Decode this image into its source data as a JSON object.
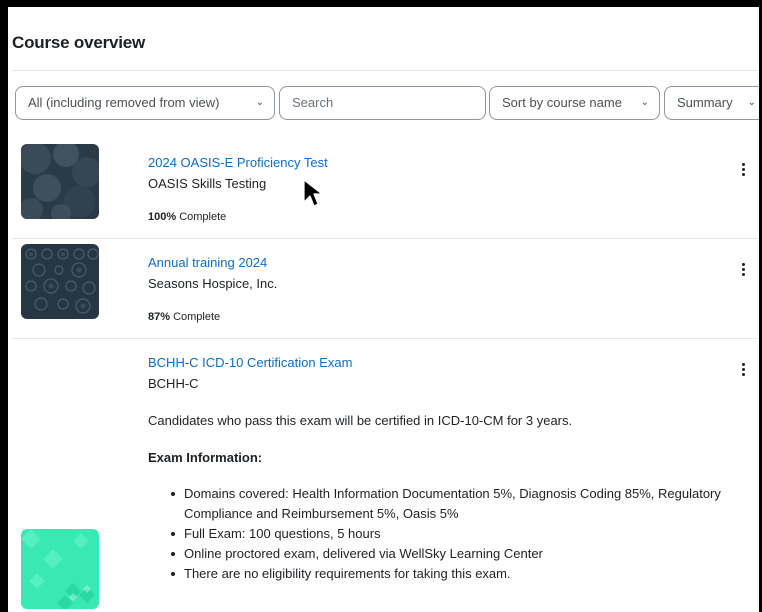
{
  "block": {
    "title": "Course overview"
  },
  "controls": {
    "filter_label": "All (including removed from view)",
    "search_placeholder": "Search",
    "sort_label": "Sort by course name",
    "view_label": "Summary"
  },
  "courses": [
    {
      "name": "2024 OASIS-E Proficiency Test",
      "category": "OASIS Skills Testing",
      "progress_value": "100%",
      "progress_suffix": " Complete",
      "progress_fraction": 1.0
    },
    {
      "name": "Annual training 2024",
      "category": "Seasons Hospice, Inc.",
      "progress_value": "87%",
      "progress_suffix": " Complete",
      "progress_fraction": 0.87
    },
    {
      "name": "BCHH-C ICD-10 Certification Exam",
      "category": "BCHH-C",
      "summary": "Candidates who pass this exam will be certified in ICD-10-CM for 3 years.",
      "exam_heading": "Exam Information:",
      "bullets": [
        "Domains covered: Health Information Documentation 5%, Diagnosis Coding 85%, Regulatory Compliance and Reimbursement 5%, Oasis 5%",
        "Full Exam: 100 questions, 5 hours",
        "Online proctored exam, delivered via WellSky Learning Center",
        "There are no eligibility requirements for taking this exam."
      ]
    }
  ],
  "icons": {
    "chevron": "chevron-down-icon",
    "kebab": "kebab-menu-icon",
    "cursor": "mouse-pointer-icon"
  },
  "colors": {
    "link": "#0f6cbf",
    "text": "#1d2125",
    "border": "#8f959e",
    "thumb_dark": "#2a3a4a",
    "thumb_teal": "#3ee8b5"
  }
}
